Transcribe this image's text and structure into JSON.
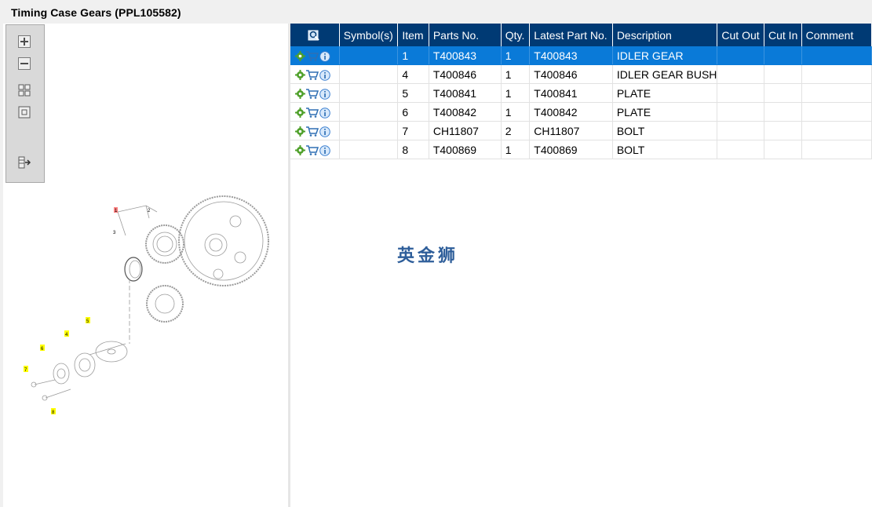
{
  "window": {
    "title": "Timing Case Gears (PPL105582)"
  },
  "toolbar": {
    "buttons": [
      "zoom-in-icon",
      "zoom-out-icon",
      "fit-page-icon",
      "actual-size-icon",
      "export-icon"
    ]
  },
  "diagram": {
    "callouts": [
      "1",
      "2",
      "3",
      "4",
      "5",
      "6",
      "7",
      "8"
    ]
  },
  "table": {
    "columns": [
      "",
      "Symbol(s)",
      "Item",
      "Parts No.",
      "Qty.",
      "Latest Part No.",
      "Description",
      "Cut Out",
      "Cut In",
      "Comment"
    ],
    "rows": [
      {
        "item": "1",
        "part_no": "T400843",
        "qty": "1",
        "latest": "T400843",
        "desc": "IDLER GEAR"
      },
      {
        "item": "4",
        "part_no": "T400846",
        "qty": "1",
        "latest": "T400846",
        "desc": "IDLER GEAR BUSH"
      },
      {
        "item": "5",
        "part_no": "T400841",
        "qty": "1",
        "latest": "T400841",
        "desc": "PLATE"
      },
      {
        "item": "6",
        "part_no": "T400842",
        "qty": "1",
        "latest": "T400842",
        "desc": "PLATE"
      },
      {
        "item": "7",
        "part_no": "CH11807",
        "qty": "2",
        "latest": "CH11807",
        "desc": "BOLT"
      },
      {
        "item": "8",
        "part_no": "T400869",
        "qty": "1",
        "latest": "T400869",
        "desc": "BOLT"
      }
    ],
    "selected_row": 0,
    "row_icons": [
      "gear-icon",
      "cart-icon",
      "info-icon"
    ]
  },
  "watermark": "英金狮",
  "colors": {
    "header": "#003a74",
    "selected": "#0a7ad8",
    "callout_highlight": "#ffff00"
  }
}
